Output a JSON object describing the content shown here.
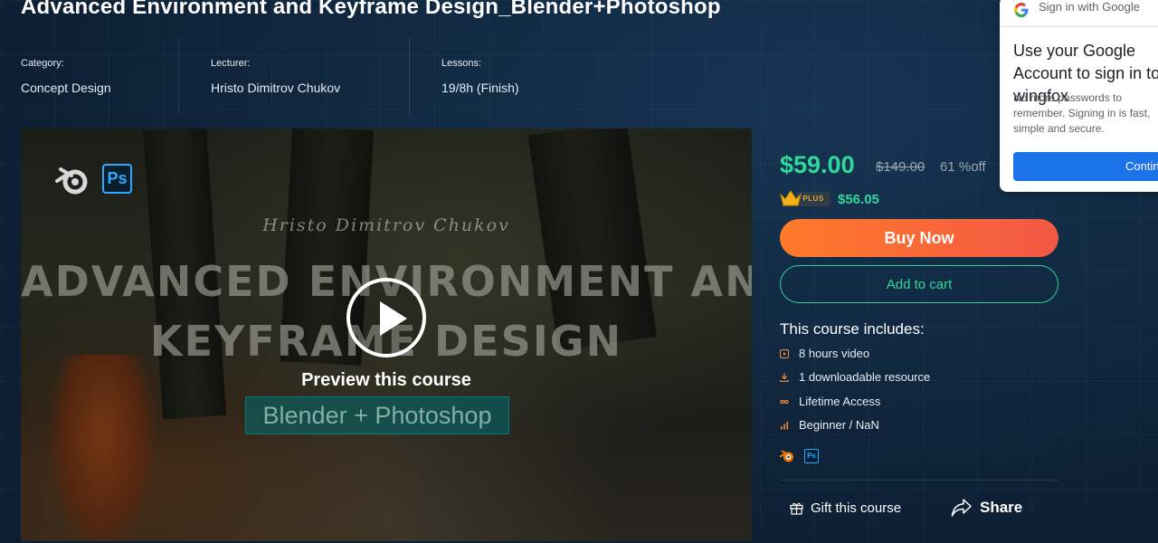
{
  "course": {
    "title": "Advanced Environment and Keyframe Design_Blender+Photoshop"
  },
  "meta": {
    "category_label": "Category:",
    "category_value": "Concept Design",
    "lecturer_label": "Lecturer:",
    "lecturer_value": "Hristo Dimitrov Chukov",
    "lessons_label": "Lessons:",
    "lessons_value": "19/8h (Finish)"
  },
  "video": {
    "ps_badge": "Ps",
    "author_script": "Hristo Dimitrov Chukov",
    "headline_line1": "ADVANCED ENVIRONMENT AND",
    "headline_line2": "KEYFRAME DESIGN",
    "preview_label": "Preview this course",
    "software_badge": "Blender + Photoshop"
  },
  "pricing": {
    "price": "$59.00",
    "original_price": "$149.00",
    "discount": "61 %off",
    "plus_badge": "PLUS",
    "plus_price": "$56.05",
    "accent_color": "#31d89c"
  },
  "actions": {
    "buy_now": "Buy Now",
    "add_to_cart": "Add to cart",
    "gift": "Gift this course",
    "share": "Share"
  },
  "includes": {
    "title": "This course includes:",
    "items": [
      {
        "icon": "video-icon",
        "text": "8 hours video"
      },
      {
        "icon": "download-icon",
        "text": "1 downloadable resource"
      },
      {
        "icon": "infinity-icon",
        "text": "Lifetime Access"
      },
      {
        "icon": "level-bars-icon",
        "text": "Beginner / NaN"
      }
    ]
  },
  "tools": {
    "ps_label": "Ps"
  },
  "google_popup": {
    "header": "Sign in with Google",
    "headline": "Use your Google Account to sign in to wingfox",
    "body": "No more passwords to remember. Signing in is fast, simple and secure.",
    "continue": "Continue"
  }
}
